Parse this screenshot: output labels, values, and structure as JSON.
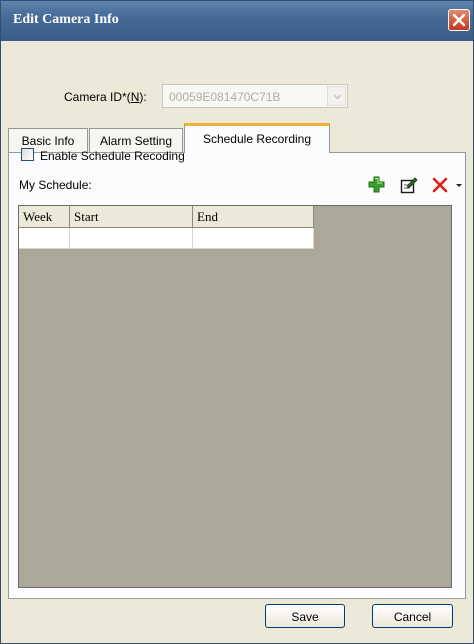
{
  "window": {
    "title": "Edit Camera Info"
  },
  "camera_id": {
    "label_prefix": "Camera ID*(",
    "label_mnemonic": "N",
    "label_suffix": "):",
    "value": "00059E081470C71B"
  },
  "tabs": [
    {
      "label": "Basic Info",
      "active": false
    },
    {
      "label": "Alarm Setting",
      "active": false
    },
    {
      "label": "Schedule Recording",
      "active": true
    }
  ],
  "schedule": {
    "enable_label": "Enable Schedule Recoding",
    "enabled": false,
    "my_schedule_label": "My Schedule:",
    "toolbar": [
      "add-icon",
      "edit-icon",
      "delete-icon",
      "dropdown-arrow-icon"
    ],
    "columns": [
      "Week",
      "Start",
      "End"
    ],
    "rows": [
      [
        "",
        "",
        ""
      ]
    ]
  },
  "buttons": {
    "save": "Save",
    "cancel": "Cancel"
  },
  "colors": {
    "titlebar": "#446a95",
    "active_tab_accent": "#f1b23a",
    "grid_background": "#aba899",
    "delete_red": "#d6201c",
    "add_green": "#3aa22a"
  }
}
